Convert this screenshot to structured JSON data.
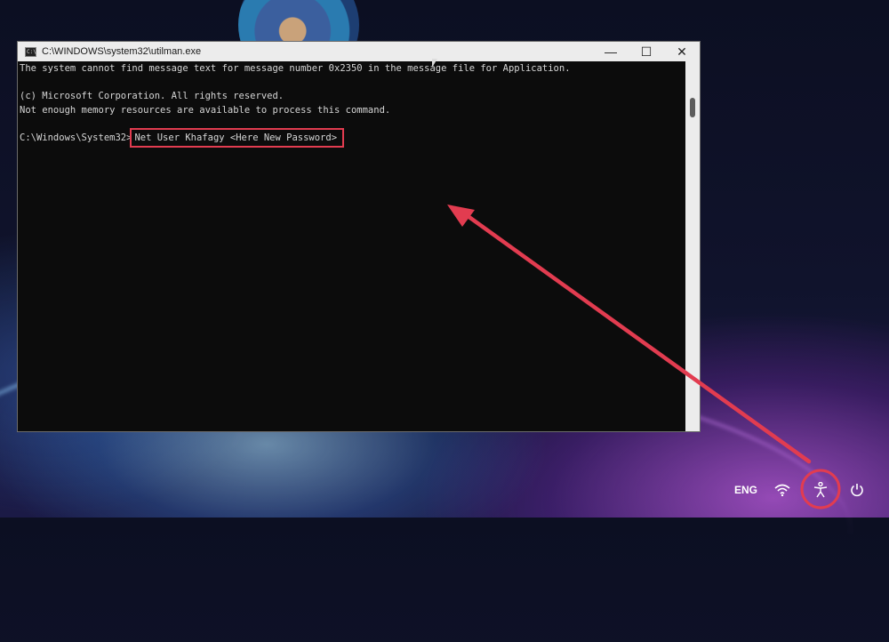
{
  "window": {
    "title": "C:\\WINDOWS\\system32\\utilman.exe",
    "app_icon_glyph": "C:\\",
    "minimize_glyph": "—",
    "maximize_glyph": "☐",
    "close_glyph": "✕"
  },
  "console": {
    "lines": [
      "The system cannot find message text for message number 0x2350 in the message file for Application.",
      "",
      "(c) Microsoft Corporation. All rights reserved.",
      "Not enough memory resources are available to process this command.",
      ""
    ],
    "prompt": "C:\\Windows\\System32>",
    "command": "Net User Khafagy <Here New Password>"
  },
  "taskbar": {
    "language": "ENG",
    "icons": [
      "wifi-icon",
      "accessibility-icon",
      "power-icon"
    ]
  },
  "colors": {
    "annotation": "#e23c50",
    "console_bg": "#0c0c0c",
    "console_text": "#d6d6d6"
  }
}
